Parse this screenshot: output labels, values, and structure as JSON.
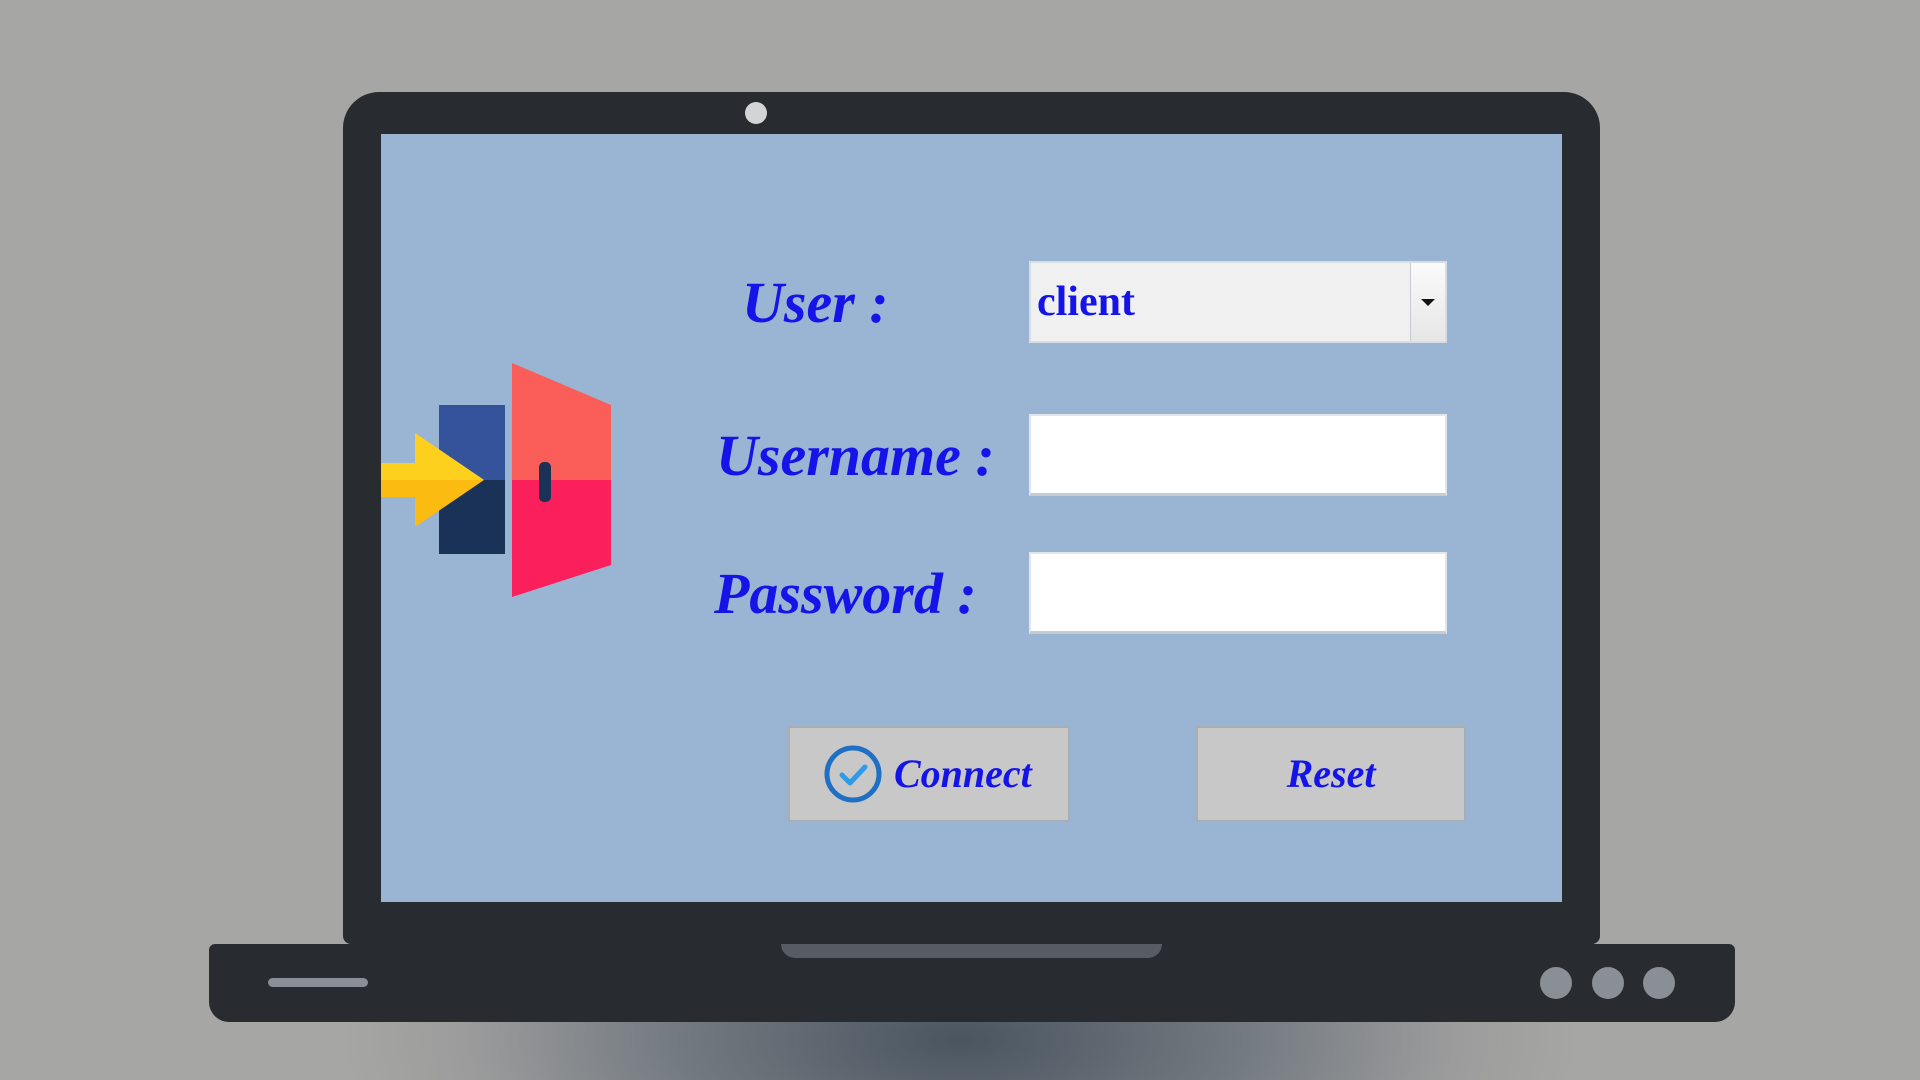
{
  "form": {
    "user_label": "User :",
    "username_label": "Username :",
    "password_label": "Password :",
    "user_select": {
      "value": "client"
    },
    "username_value": "",
    "password_value": ""
  },
  "buttons": {
    "connect_label": "Connect",
    "reset_label": "Reset"
  },
  "colors": {
    "screen_background": "#9ab4d3",
    "label_text": "#1414e8",
    "laptop_body": "#282b2f",
    "button_face": "#c8c8c8"
  },
  "icons": {
    "logo": "login-door-arrow-icon",
    "connect": "check-circle-icon",
    "dropdown": "chevron-down-icon"
  }
}
